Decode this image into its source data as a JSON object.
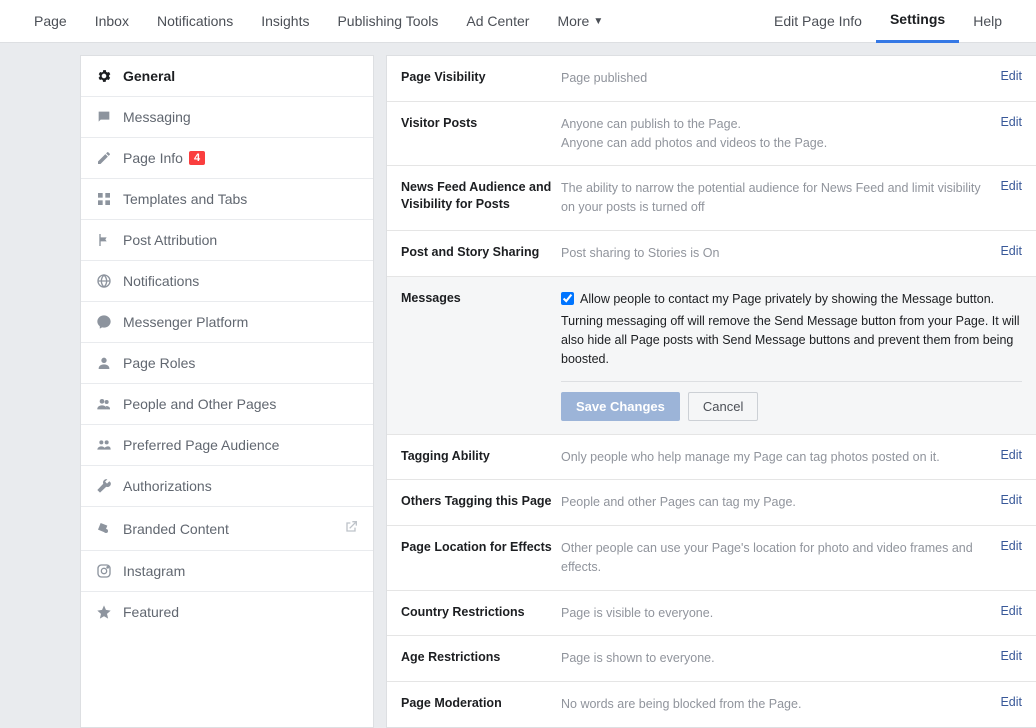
{
  "topnav": {
    "left": [
      "Page",
      "Inbox",
      "Notifications",
      "Insights",
      "Publishing Tools",
      "Ad Center",
      "More"
    ],
    "right": [
      "Edit Page Info",
      "Settings",
      "Help"
    ],
    "active_right": "Settings"
  },
  "sidebar": {
    "items": [
      {
        "label": "General",
        "icon": "gear",
        "active": true
      },
      {
        "label": "Messaging",
        "icon": "message"
      },
      {
        "label": "Page Info",
        "icon": "pencil",
        "badge": "4"
      },
      {
        "label": "Templates and Tabs",
        "icon": "grid"
      },
      {
        "label": "Post Attribution",
        "icon": "flag"
      },
      {
        "label": "Notifications",
        "icon": "globe"
      },
      {
        "label": "Messenger Platform",
        "icon": "messenger"
      },
      {
        "label": "Page Roles",
        "icon": "person"
      },
      {
        "label": "People and Other Pages",
        "icon": "people"
      },
      {
        "label": "Preferred Page Audience",
        "icon": "audience"
      },
      {
        "label": "Authorizations",
        "icon": "wrench"
      },
      {
        "label": "Branded Content",
        "icon": "branded",
        "extlink": true
      },
      {
        "label": "Instagram",
        "icon": "instagram"
      },
      {
        "label": "Featured",
        "icon": "star"
      }
    ]
  },
  "rows": [
    {
      "label": "Page Visibility",
      "value": "Page published"
    },
    {
      "label": "Visitor Posts",
      "value": "Anyone can publish to the Page.\nAnyone can add photos and videos to the Page."
    },
    {
      "label": "News Feed Audience and Visibility for Posts",
      "value": "The ability to narrow the potential audience for News Feed and limit visibility on your posts is turned off"
    },
    {
      "label": "Post and Story Sharing",
      "value": "Post sharing to Stories is On"
    },
    {
      "label": "Messages",
      "expanded": true,
      "checkbox_label": "Allow people to contact my Page privately by showing the Message button.",
      "desc": "Turning messaging off will remove the Send Message button from your Page. It will also hide all Page posts with Send Message buttons and prevent them from being boosted.",
      "save": "Save Changes",
      "cancel": "Cancel"
    },
    {
      "label": "Tagging Ability",
      "value": "Only people who help manage my Page can tag photos posted on it."
    },
    {
      "label": "Others Tagging this Page",
      "value": "People and other Pages can tag my Page."
    },
    {
      "label": "Page Location for Effects",
      "value": "Other people can use your Page's location for photo and video frames and effects."
    },
    {
      "label": "Country Restrictions",
      "value": "Page is visible to everyone."
    },
    {
      "label": "Age Restrictions",
      "value": "Page is shown to everyone."
    },
    {
      "label": "Page Moderation",
      "value": "No words are being blocked from the Page."
    }
  ],
  "edit_label": "Edit"
}
